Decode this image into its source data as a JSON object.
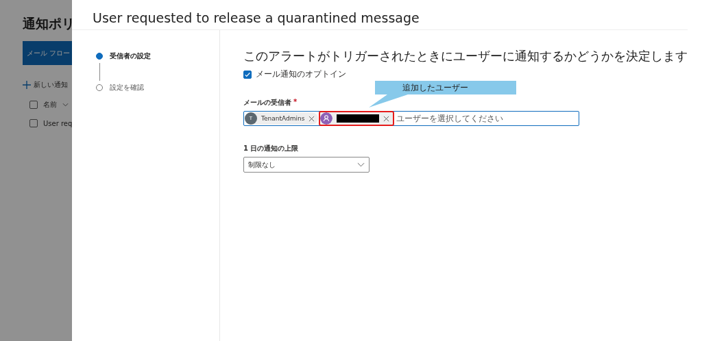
{
  "background_page": {
    "title": "通知ポリ",
    "primary_button": "メール フロー",
    "new_button": "新しい通知",
    "header_checkbox": {
      "checked": false
    },
    "column_header": "名前",
    "row_checkbox": {
      "checked": false
    },
    "row_name": "User req"
  },
  "panel": {
    "title": "User requested to release a quarantined message",
    "steps": [
      {
        "label": "受信者の設定",
        "selected": true
      },
      {
        "label": "設定を確認",
        "selected": false
      }
    ],
    "heading": "このアラートがトリガーされたときにユーザーに通知するかどうかを決定します",
    "opt_in": {
      "label": "メール通知のオプトイン",
      "checked": true
    },
    "recipients": {
      "label": "メールの受信者",
      "required": "*",
      "placeholder": "ユーザーを選択してください",
      "chips": [
        {
          "kind": "initial",
          "initial": "T",
          "name": "TenantAdmins",
          "highlighted": false
        },
        {
          "kind": "person",
          "highlighted": true
        }
      ]
    },
    "callout": {
      "text": "追加したユーザー"
    },
    "daily_limit": {
      "label": "1 日の通知の上限",
      "value": "制限なし"
    }
  }
}
